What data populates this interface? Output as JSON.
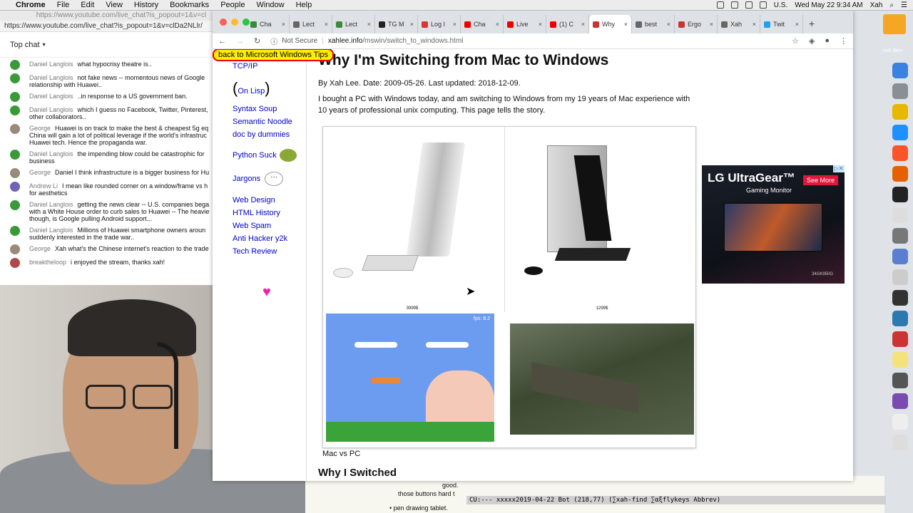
{
  "menubar": {
    "app": "Chrome",
    "items": [
      "File",
      "Edit",
      "View",
      "History",
      "Bookmarks",
      "People",
      "Window",
      "Help"
    ],
    "region": "U.S.",
    "datetime": "Wed May 22  9:34 AM",
    "user": "Xah"
  },
  "chat": {
    "window_title": "https://www.youtube.com/live_chat?is_popout=1&v=cl",
    "url": "https://www.youtube.com/live_chat?is_popout=1&v=clDa2NLlr/",
    "header": "Top chat",
    "messages": [
      {
        "author": "Daniel Langlois",
        "text": "what hypocrisy theatre is..",
        "avatar": "green"
      },
      {
        "author": "Daniel Langlois",
        "text": "not fake news -- momentous news of Google relationship with Huawei..",
        "avatar": "green"
      },
      {
        "author": "Daniel Langlois",
        "text": "..in response to a US government ban.",
        "avatar": "green"
      },
      {
        "author": "Daniel Langlois",
        "text": "which I guess no Facebook, Twitter, Pinterest, other collaborators..",
        "avatar": "green"
      },
      {
        "author": "George",
        "text": "Huawei is on track to make the best & cheapest 5g eq China will gain a lot of political leverage if the world's infrastruc Huawei tech. Hence the propaganda war.",
        "avatar": "gray"
      },
      {
        "author": "Daniel Langlois",
        "text": "the impending blow could be catastrophic for business",
        "avatar": "green"
      },
      {
        "author": "George",
        "text": "Daniel I think infrastructure is a bigger business for Hu",
        "avatar": "gray"
      },
      {
        "author": "Andrew Li",
        "text": "I mean like rounded corner on a window/frame vs h for aesthetics",
        "avatar": "purple"
      },
      {
        "author": "Daniel Langlois",
        "text": "getting the news clear -- U.S. companies bega with a White House order to curb sales to Huawei -- The heavie though, is Google pulling Android support...",
        "avatar": "green"
      },
      {
        "author": "Daniel Langlois",
        "text": "Millions of Huawei smartphone owners aroun suddenly interested in the trade war..",
        "avatar": "green"
      },
      {
        "author": "George",
        "text": "Xah what's the Chinese internet's reaction to the trade",
        "avatar": "gray"
      },
      {
        "author": "breaktheloop",
        "text": "i enjoyed the stream, thanks xah!",
        "avatar": "red"
      }
    ]
  },
  "browser": {
    "tabs": [
      {
        "label": "Cha",
        "color": "#3a8a3a"
      },
      {
        "label": "Lect",
        "color": "#666"
      },
      {
        "label": "Lect",
        "color": "#3a8a3a"
      },
      {
        "label": "TG M",
        "color": "#222"
      },
      {
        "label": "Log I",
        "color": "#d33"
      },
      {
        "label": "Cha",
        "color": "#e00"
      },
      {
        "label": "Live",
        "color": "#e00"
      },
      {
        "label": "(1) C",
        "color": "#e00"
      },
      {
        "label": "Why",
        "color": "#c33",
        "active": true
      },
      {
        "label": "best",
        "color": "#666"
      },
      {
        "label": "Ergo",
        "color": "#c33"
      },
      {
        "label": "Xah",
        "color": "#666"
      },
      {
        "label": "Twit",
        "color": "#1da1f2"
      }
    ],
    "address": {
      "security": "Not Secure",
      "host": "xahlee.info",
      "path": "/mswin/switch_to_windows.html"
    }
  },
  "page": {
    "back_link": "back to Microsoft Windows Tips",
    "nav": {
      "top": "TCP/IP",
      "on_lisp": "On Lisp",
      "group1": [
        "Syntax Soup",
        "Semantic Noodle",
        "doc by dummies"
      ],
      "python": "Python Suck",
      "jargons": "Jargons",
      "group2": [
        "Web Design",
        "HTML History",
        "Web Spam",
        "Anti Hacker y2k",
        "Tech Review"
      ]
    },
    "title": "Why I'm Switching from Mac to Windows",
    "byline": "By Xah Lee. Date: 2009-05-26. Last updated: 2018-12-09.",
    "intro": "I bought a PC with Windows today, and am switching to Windows from my 19 years of Mac experience with 10 years of professional unix computing. This page tells the story.",
    "price_mac": "3999$",
    "price_pc": "1299$",
    "fps": "fps: 8.2",
    "figure_caption": "Mac vs PC",
    "section_heading": "Why I Switched"
  },
  "ad": {
    "brand": "LG UltraGear™",
    "sub": "Gaming Monitor",
    "cta": "See More",
    "model": "34GK950G"
  },
  "emacs": {
    "lines": [
      "good.",
      "those buttons hard t",
      "• pen drawing tablet."
    ],
    "modeline": "CU:---  xxxxx2019-04-22   Bot (218,77)   (∑xah-find ∑αξflykeys Abbrev)"
  },
  "desktop": {
    "label": "osh Serv"
  }
}
